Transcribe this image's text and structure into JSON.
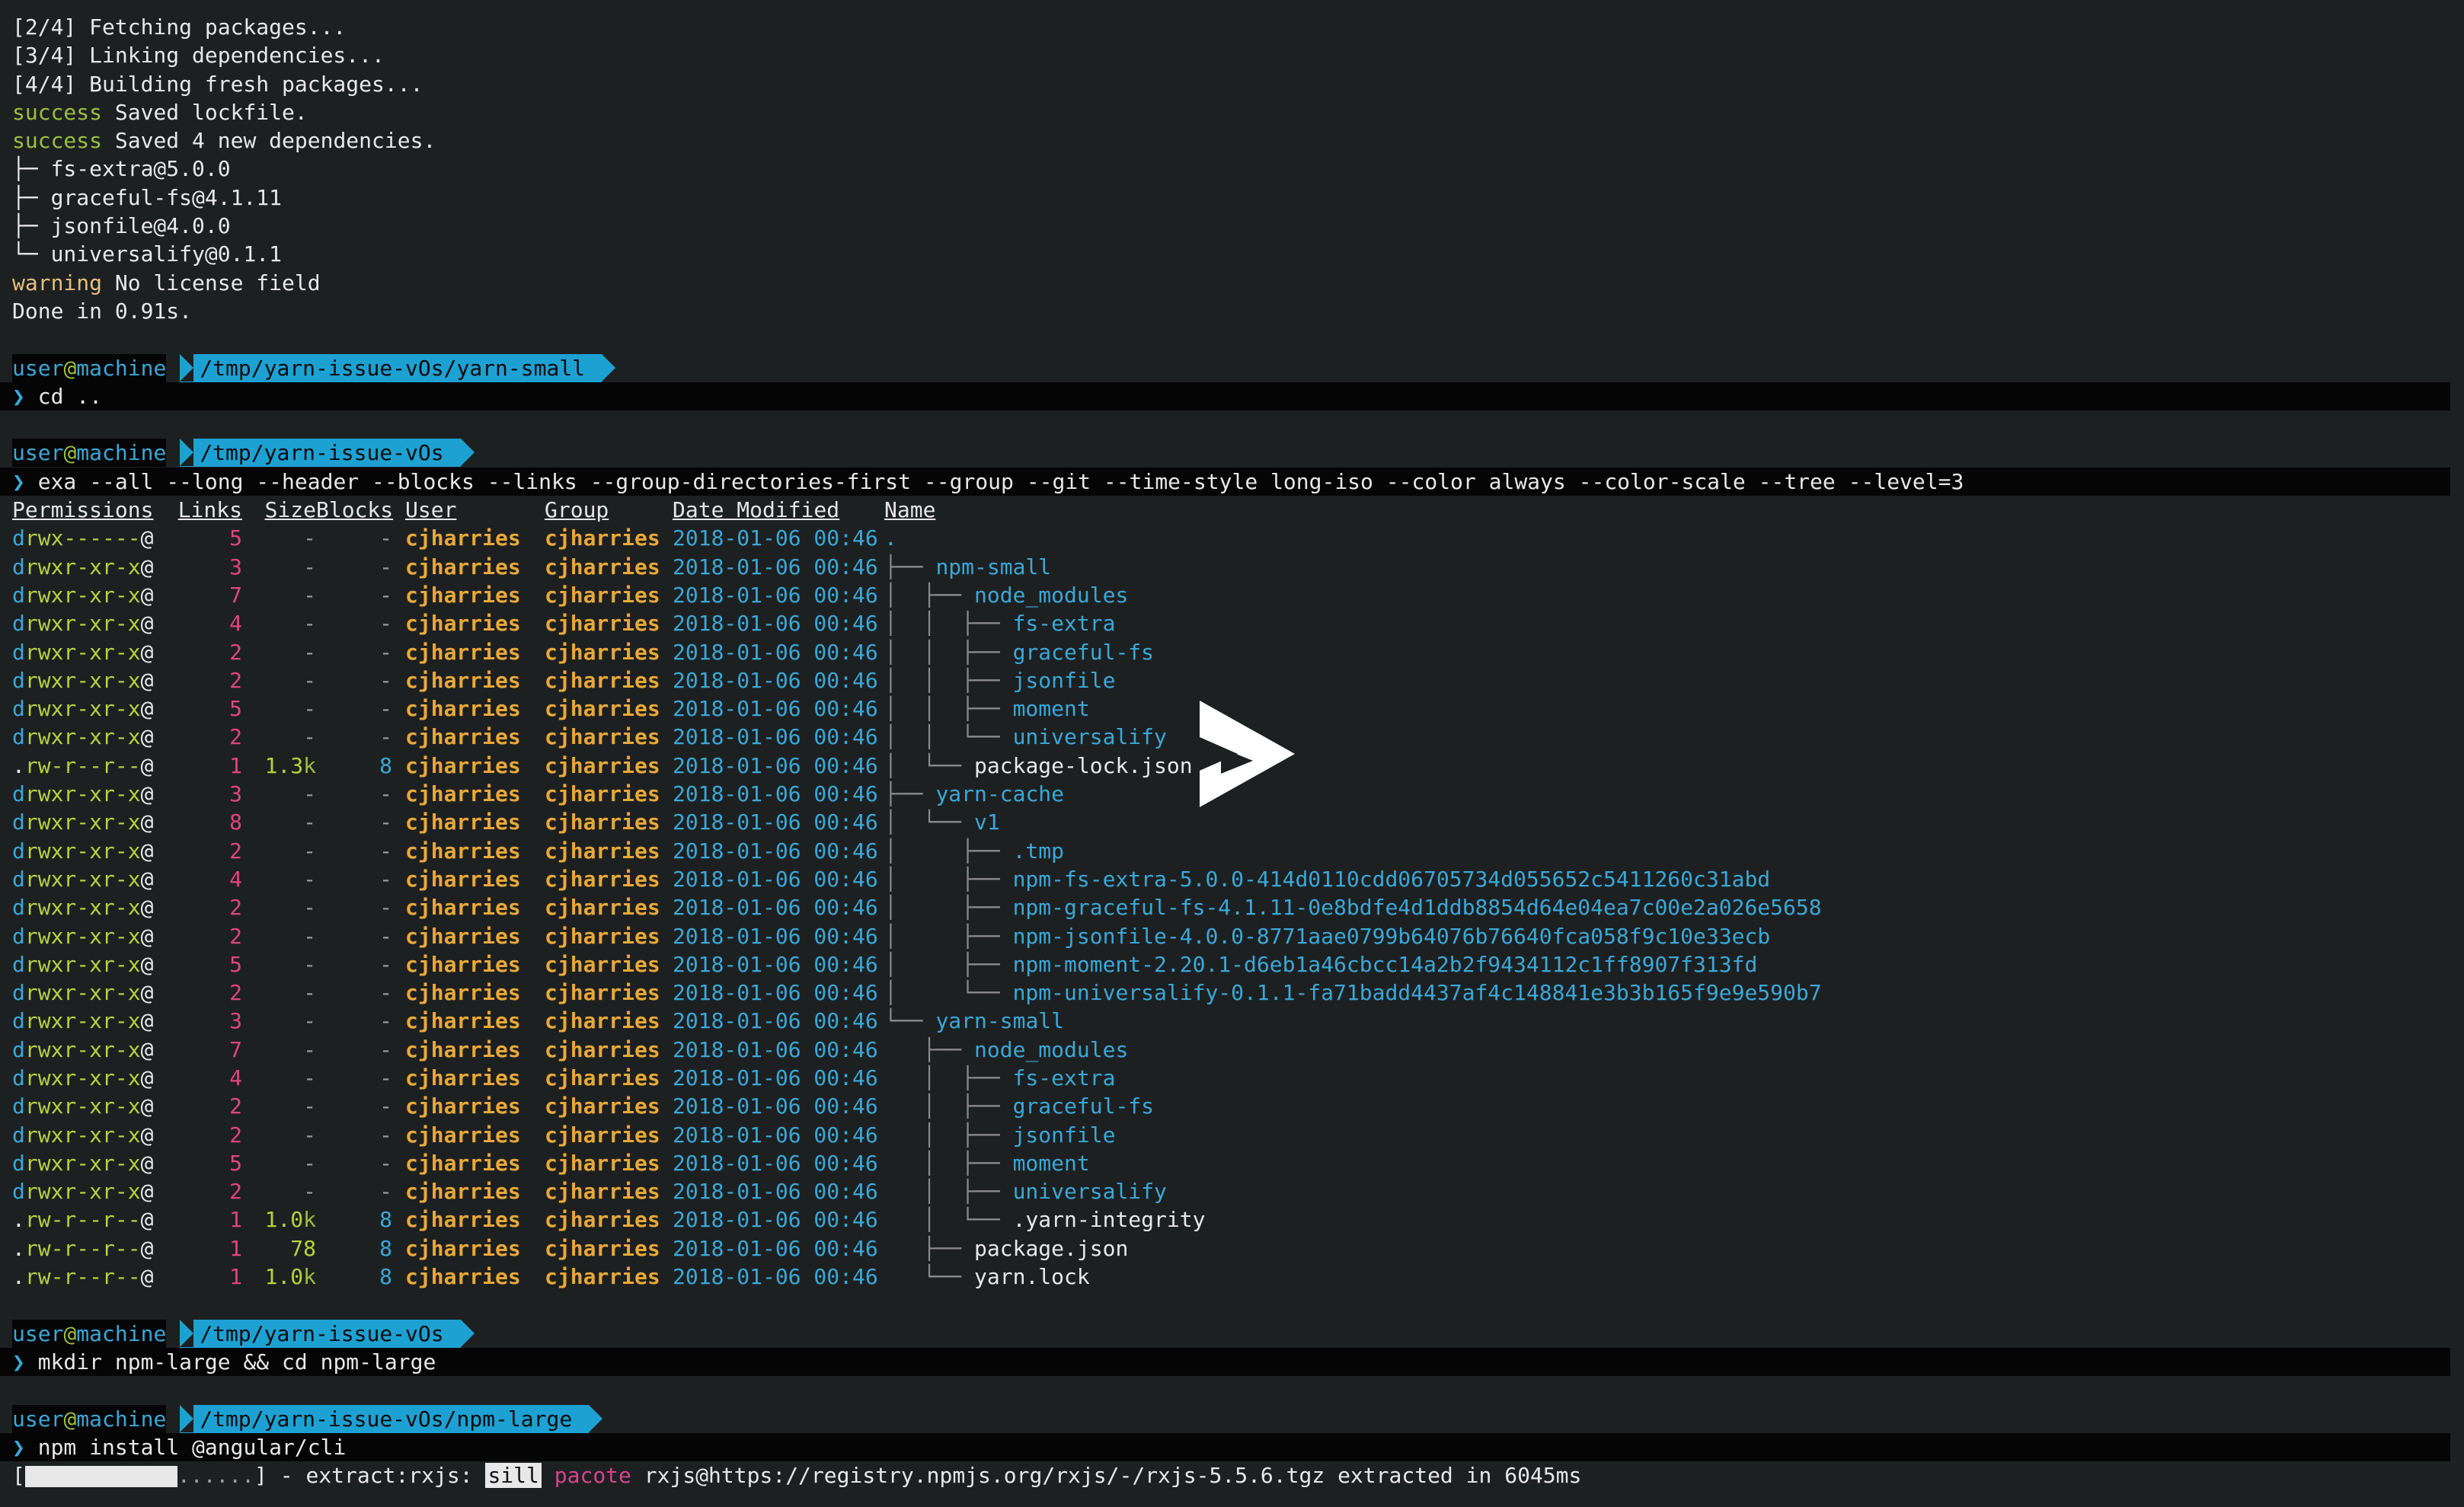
{
  "colors": {
    "background": "#1d2021",
    "success": "#9bbf3e",
    "warning": "#e5c07b",
    "accent": "#1da1d3",
    "owner": "#e8a838",
    "links": "#e0457b",
    "size": "#b5d33b"
  },
  "output_before": [
    "[2/4] Fetching packages...",
    "[3/4] Linking dependencies...",
    "[4/4] Building fresh packages..."
  ],
  "success_lines": [
    {
      "tag": "success",
      "text": " Saved lockfile."
    },
    {
      "tag": "success",
      "text": " Saved 4 new dependencies."
    }
  ],
  "deps": [
    "├─ fs-extra@5.0.0",
    "├─ graceful-fs@4.1.11",
    "├─ jsonfile@4.0.0",
    "└─ universalify@0.1.1"
  ],
  "warning": {
    "tag": "warning",
    "text": " No license field"
  },
  "done": "Done in 0.91s.",
  "prompts": [
    {
      "user": "user",
      "at": "@",
      "host": "machine",
      "path": "/tmp/yarn-issue-vOs/yarn-small",
      "command": "cd .."
    },
    {
      "user": "user",
      "at": "@",
      "host": "machine",
      "path": "/tmp/yarn-issue-vOs",
      "command": "exa --all --long --header --blocks --links --group-directories-first --group --git --time-style long-iso --color always --color-scale --tree --level=3"
    },
    {
      "user": "user",
      "at": "@",
      "host": "machine",
      "path": "/tmp/yarn-issue-vOs",
      "command": "mkdir npm-large && cd npm-large"
    },
    {
      "user": "user",
      "at": "@",
      "host": "machine",
      "path": "/tmp/yarn-issue-vOs/npm-large",
      "command": "npm install @angular/cli"
    }
  ],
  "prompt_symbol": "❯",
  "listing": {
    "headers": {
      "perm": "Permissions",
      "links": "Links",
      "size": "Size",
      "blocks": "Blocks",
      "user": "User",
      "group": "Group",
      "date": "Date Modified",
      "name": "Name"
    },
    "rows": [
      {
        "type": "d",
        "perm": "rwx------",
        "links": "5",
        "size": "-",
        "sizek": "",
        "blocks": "-",
        "user": "cjharries",
        "group": "cjharries",
        "date": "2018-01-06 00:46",
        "tree": "",
        "name": ".",
        "isdir": true
      },
      {
        "type": "d",
        "perm": "rwxr-xr-x",
        "links": "3",
        "size": "-",
        "sizek": "",
        "blocks": "-",
        "user": "cjharries",
        "group": "cjharries",
        "date": "2018-01-06 00:46",
        "tree": "├── ",
        "name": "npm-small",
        "isdir": true
      },
      {
        "type": "d",
        "perm": "rwxr-xr-x",
        "links": "7",
        "size": "-",
        "sizek": "",
        "blocks": "-",
        "user": "cjharries",
        "group": "cjharries",
        "date": "2018-01-06 00:46",
        "tree": "│  ├── ",
        "name": "node_modules",
        "isdir": true
      },
      {
        "type": "d",
        "perm": "rwxr-xr-x",
        "links": "4",
        "size": "-",
        "sizek": "",
        "blocks": "-",
        "user": "cjharries",
        "group": "cjharries",
        "date": "2018-01-06 00:46",
        "tree": "│  │  ├── ",
        "name": "fs-extra",
        "isdir": true
      },
      {
        "type": "d",
        "perm": "rwxr-xr-x",
        "links": "2",
        "size": "-",
        "sizek": "",
        "blocks": "-",
        "user": "cjharries",
        "group": "cjharries",
        "date": "2018-01-06 00:46",
        "tree": "│  │  ├── ",
        "name": "graceful-fs",
        "isdir": true
      },
      {
        "type": "d",
        "perm": "rwxr-xr-x",
        "links": "2",
        "size": "-",
        "sizek": "",
        "blocks": "-",
        "user": "cjharries",
        "group": "cjharries",
        "date": "2018-01-06 00:46",
        "tree": "│  │  ├── ",
        "name": "jsonfile",
        "isdir": true
      },
      {
        "type": "d",
        "perm": "rwxr-xr-x",
        "links": "5",
        "size": "-",
        "sizek": "",
        "blocks": "-",
        "user": "cjharries",
        "group": "cjharries",
        "date": "2018-01-06 00:46",
        "tree": "│  │  ├── ",
        "name": "moment",
        "isdir": true
      },
      {
        "type": "d",
        "perm": "rwxr-xr-x",
        "links": "2",
        "size": "-",
        "sizek": "",
        "blocks": "-",
        "user": "cjharries",
        "group": "cjharries",
        "date": "2018-01-06 00:46",
        "tree": "│  │  └── ",
        "name": "universalify",
        "isdir": true
      },
      {
        "type": ".",
        "perm": "rw-r--r--",
        "links": "1",
        "size": "1.3",
        "sizek": "k",
        "blocks": "8",
        "user": "cjharries",
        "group": "cjharries",
        "date": "2018-01-06 00:46",
        "tree": "│  └── ",
        "name": "package-lock.json",
        "isdir": false
      },
      {
        "type": "d",
        "perm": "rwxr-xr-x",
        "links": "3",
        "size": "-",
        "sizek": "",
        "blocks": "-",
        "user": "cjharries",
        "group": "cjharries",
        "date": "2018-01-06 00:46",
        "tree": "├── ",
        "name": "yarn-cache",
        "isdir": true
      },
      {
        "type": "d",
        "perm": "rwxr-xr-x",
        "links": "8",
        "size": "-",
        "sizek": "",
        "blocks": "-",
        "user": "cjharries",
        "group": "cjharries",
        "date": "2018-01-06 00:46",
        "tree": "│  └── ",
        "name": "v1",
        "isdir": true
      },
      {
        "type": "d",
        "perm": "rwxr-xr-x",
        "links": "2",
        "size": "-",
        "sizek": "",
        "blocks": "-",
        "user": "cjharries",
        "group": "cjharries",
        "date": "2018-01-06 00:46",
        "tree": "│     ├── ",
        "name": ".tmp",
        "isdir": true
      },
      {
        "type": "d",
        "perm": "rwxr-xr-x",
        "links": "4",
        "size": "-",
        "sizek": "",
        "blocks": "-",
        "user": "cjharries",
        "group": "cjharries",
        "date": "2018-01-06 00:46",
        "tree": "│     ├── ",
        "name": "npm-fs-extra-5.0.0-414d0110cdd06705734d055652c5411260c31abd",
        "isdir": true
      },
      {
        "type": "d",
        "perm": "rwxr-xr-x",
        "links": "2",
        "size": "-",
        "sizek": "",
        "blocks": "-",
        "user": "cjharries",
        "group": "cjharries",
        "date": "2018-01-06 00:46",
        "tree": "│     ├── ",
        "name": "npm-graceful-fs-4.1.11-0e8bdfe4d1ddb8854d64e04ea7c00e2a026e5658",
        "isdir": true
      },
      {
        "type": "d",
        "perm": "rwxr-xr-x",
        "links": "2",
        "size": "-",
        "sizek": "",
        "blocks": "-",
        "user": "cjharries",
        "group": "cjharries",
        "date": "2018-01-06 00:46",
        "tree": "│     ├── ",
        "name": "npm-jsonfile-4.0.0-8771aae0799b64076b76640fca058f9c10e33ecb",
        "isdir": true
      },
      {
        "type": "d",
        "perm": "rwxr-xr-x",
        "links": "5",
        "size": "-",
        "sizek": "",
        "blocks": "-",
        "user": "cjharries",
        "group": "cjharries",
        "date": "2018-01-06 00:46",
        "tree": "│     ├── ",
        "name": "npm-moment-2.20.1-d6eb1a46cbcc14a2b2f9434112c1ff8907f313fd",
        "isdir": true
      },
      {
        "type": "d",
        "perm": "rwxr-xr-x",
        "links": "2",
        "size": "-",
        "sizek": "",
        "blocks": "-",
        "user": "cjharries",
        "group": "cjharries",
        "date": "2018-01-06 00:46",
        "tree": "│     └── ",
        "name": "npm-universalify-0.1.1-fa71badd4437af4c148841e3b3b165f9e9e590b7",
        "isdir": true
      },
      {
        "type": "d",
        "perm": "rwxr-xr-x",
        "links": "3",
        "size": "-",
        "sizek": "",
        "blocks": "-",
        "user": "cjharries",
        "group": "cjharries",
        "date": "2018-01-06 00:46",
        "tree": "└── ",
        "name": "yarn-small",
        "isdir": true
      },
      {
        "type": "d",
        "perm": "rwxr-xr-x",
        "links": "7",
        "size": "-",
        "sizek": "",
        "blocks": "-",
        "user": "cjharries",
        "group": "cjharries",
        "date": "2018-01-06 00:46",
        "tree": "   ├── ",
        "name": "node_modules",
        "isdir": true
      },
      {
        "type": "d",
        "perm": "rwxr-xr-x",
        "links": "4",
        "size": "-",
        "sizek": "",
        "blocks": "-",
        "user": "cjharries",
        "group": "cjharries",
        "date": "2018-01-06 00:46",
        "tree": "   │  ├── ",
        "name": "fs-extra",
        "isdir": true
      },
      {
        "type": "d",
        "perm": "rwxr-xr-x",
        "links": "2",
        "size": "-",
        "sizek": "",
        "blocks": "-",
        "user": "cjharries",
        "group": "cjharries",
        "date": "2018-01-06 00:46",
        "tree": "   │  ├── ",
        "name": "graceful-fs",
        "isdir": true
      },
      {
        "type": "d",
        "perm": "rwxr-xr-x",
        "links": "2",
        "size": "-",
        "sizek": "",
        "blocks": "-",
        "user": "cjharries",
        "group": "cjharries",
        "date": "2018-01-06 00:46",
        "tree": "   │  ├── ",
        "name": "jsonfile",
        "isdir": true
      },
      {
        "type": "d",
        "perm": "rwxr-xr-x",
        "links": "5",
        "size": "-",
        "sizek": "",
        "blocks": "-",
        "user": "cjharries",
        "group": "cjharries",
        "date": "2018-01-06 00:46",
        "tree": "   │  ├── ",
        "name": "moment",
        "isdir": true
      },
      {
        "type": "d",
        "perm": "rwxr-xr-x",
        "links": "2",
        "size": "-",
        "sizek": "",
        "blocks": "-",
        "user": "cjharries",
        "group": "cjharries",
        "date": "2018-01-06 00:46",
        "tree": "   │  ├── ",
        "name": "universalify",
        "isdir": true
      },
      {
        "type": ".",
        "perm": "rw-r--r--",
        "links": "1",
        "size": "1.0",
        "sizek": "k",
        "blocks": "8",
        "user": "cjharries",
        "group": "cjharries",
        "date": "2018-01-06 00:46",
        "tree": "   │  └── ",
        "name": ".yarn-integrity",
        "isdir": false
      },
      {
        "type": ".",
        "perm": "rw-r--r--",
        "links": "1",
        "size": "78",
        "sizek": "",
        "blocks": "8",
        "user": "cjharries",
        "group": "cjharries",
        "date": "2018-01-06 00:46",
        "tree": "   ├── ",
        "name": "package.json",
        "isdir": false
      },
      {
        "type": ".",
        "perm": "rw-r--r--",
        "links": "1",
        "size": "1.0",
        "sizek": "k",
        "blocks": "8",
        "user": "cjharries",
        "group": "cjharries",
        "date": "2018-01-06 00:46",
        "tree": "   └── ",
        "name": "yarn.lock",
        "isdir": false
      }
    ]
  },
  "npm_progress": {
    "open": "[",
    "dots": "......",
    "close": "] - extract:rxjs: ",
    "level": "sill",
    "tool": "pacote",
    "message": " rxjs@https://registry.npmjs.org/rxjs/-/rxjs-5.5.6.tgz extracted in 6045ms"
  },
  "overlay": {
    "icon": "play-icon"
  }
}
